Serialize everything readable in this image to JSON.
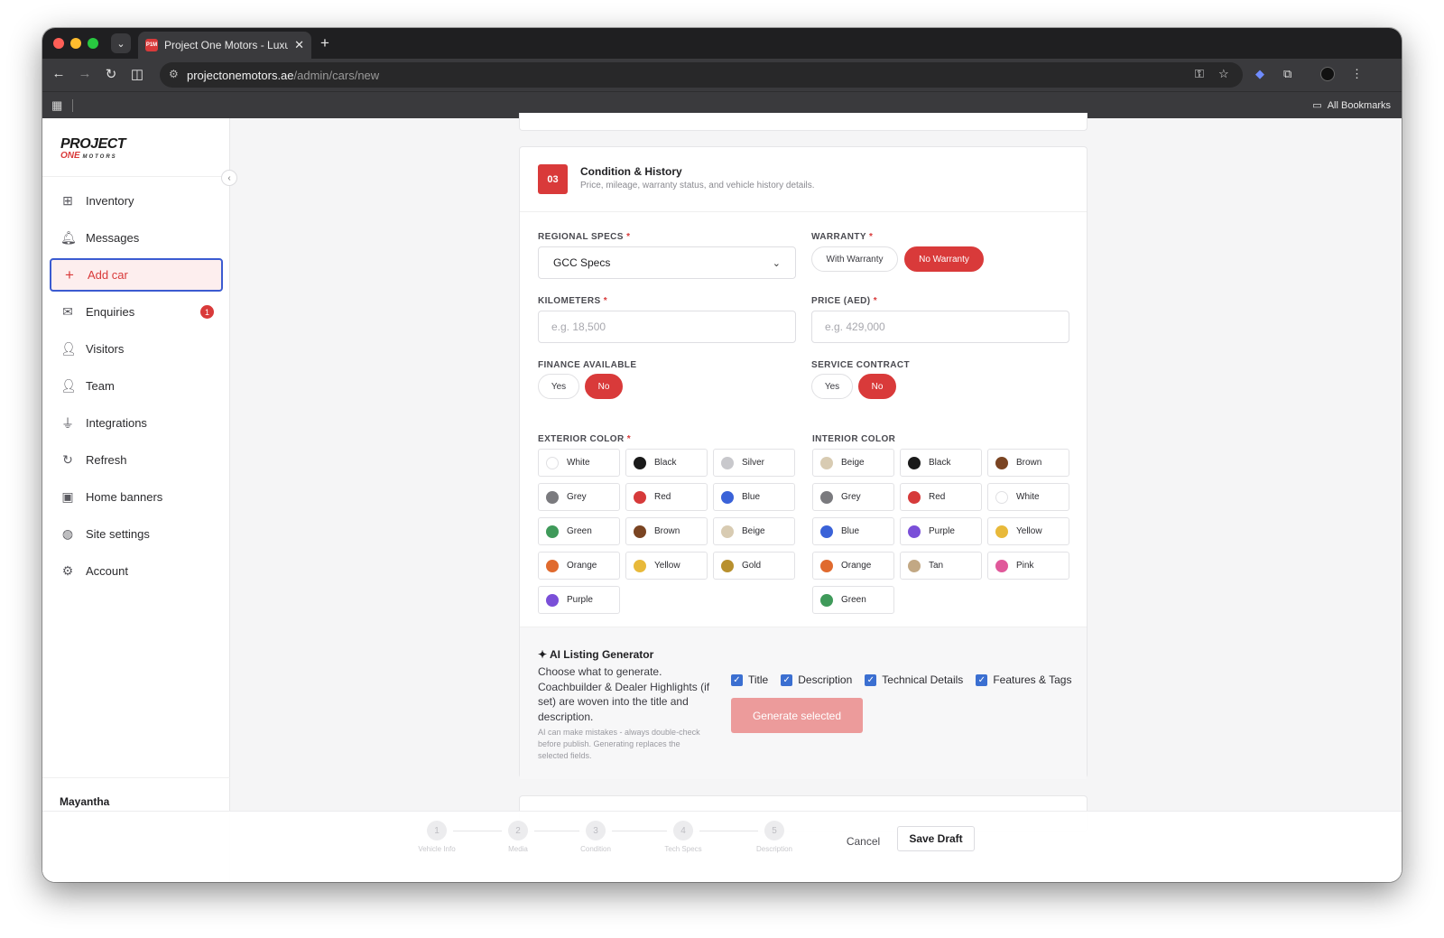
{
  "browser": {
    "tab_title": "Project One Motors - Luxury",
    "favicon_text": "P1M",
    "url_host": "projectonemotors.ae",
    "url_path": "/admin/cars/new",
    "bookmarks_all": "All Bookmarks"
  },
  "sidebar": {
    "logo_line1": "PROJECT",
    "logo_line2": "ONE",
    "logo_line3": "MOTORS",
    "items": [
      {
        "label": "Inventory",
        "icon": "grid-icon",
        "glyph": "⊞"
      },
      {
        "label": "Messages",
        "icon": "bell-icon",
        "glyph": "🔔︎"
      },
      {
        "label": "Add car",
        "icon": "plus-icon",
        "glyph": "+"
      },
      {
        "label": "Enquiries",
        "icon": "mail-icon",
        "glyph": "✉",
        "badge": "1"
      },
      {
        "label": "Visitors",
        "icon": "user-icon",
        "glyph": "👤︎"
      },
      {
        "label": "Team",
        "icon": "users-icon",
        "glyph": "👤︎"
      },
      {
        "label": "Integrations",
        "icon": "plug-icon",
        "glyph": "⏚"
      },
      {
        "label": "Refresh",
        "icon": "refresh-icon",
        "glyph": "↻"
      },
      {
        "label": "Home banners",
        "icon": "image-icon",
        "glyph": "▣"
      },
      {
        "label": "Site settings",
        "icon": "globe-icon",
        "glyph": "◍"
      },
      {
        "label": "Account",
        "icon": "gear-icon",
        "glyph": "⚙"
      }
    ],
    "user_name": "Mayantha"
  },
  "section": {
    "number": "03",
    "title": "Condition & History",
    "subtitle": "Price, mileage, warranty status, and vehicle history details."
  },
  "form": {
    "regional_specs": {
      "label": "REGIONAL SPECS",
      "value": "GCC Specs"
    },
    "warranty": {
      "label": "WARRANTY",
      "options": [
        "With Warranty",
        "No Warranty"
      ],
      "selected": "No Warranty"
    },
    "kilometers": {
      "label": "KILOMETERS",
      "placeholder": "e.g. 18,500",
      "value": ""
    },
    "price": {
      "label": "PRICE (AED)",
      "placeholder": "e.g. 429,000",
      "value": ""
    },
    "finance": {
      "label": "FINANCE AVAILABLE",
      "options": [
        "Yes",
        "No"
      ],
      "selected": "No"
    },
    "service_contract": {
      "label": "SERVICE CONTRACT",
      "options": [
        "Yes",
        "No"
      ],
      "selected": "No"
    },
    "required_mark": "*"
  },
  "exterior_color": {
    "label": "EXTERIOR COLOR",
    "colors": [
      {
        "name": "White",
        "hex": "#ffffff"
      },
      {
        "name": "Black",
        "hex": "#1a1a1a"
      },
      {
        "name": "Silver",
        "hex": "#c8c8cc"
      },
      {
        "name": "Grey",
        "hex": "#7a7a7e"
      },
      {
        "name": "Red",
        "hex": "#d63a3a"
      },
      {
        "name": "Blue",
        "hex": "#3a62d8"
      },
      {
        "name": "Green",
        "hex": "#3f9a5a"
      },
      {
        "name": "Brown",
        "hex": "#7a4422"
      },
      {
        "name": "Beige",
        "hex": "#d8cbb2"
      },
      {
        "name": "Orange",
        "hex": "#e06a2e"
      },
      {
        "name": "Yellow",
        "hex": "#e8b93a"
      },
      {
        "name": "Gold",
        "hex": "#b8902e"
      },
      {
        "name": "Purple",
        "hex": "#7a4fd8"
      }
    ]
  },
  "interior_color": {
    "label": "INTERIOR COLOR",
    "colors": [
      {
        "name": "Beige",
        "hex": "#d8cbb2"
      },
      {
        "name": "Black",
        "hex": "#1a1a1a"
      },
      {
        "name": "Brown",
        "hex": "#7a4422"
      },
      {
        "name": "Grey",
        "hex": "#7a7a7e"
      },
      {
        "name": "Red",
        "hex": "#d63a3a"
      },
      {
        "name": "White",
        "hex": "#ffffff"
      },
      {
        "name": "Blue",
        "hex": "#3a62d8"
      },
      {
        "name": "Purple",
        "hex": "#7a4fd8"
      },
      {
        "name": "Yellow",
        "hex": "#e8b93a"
      },
      {
        "name": "Orange",
        "hex": "#e06a2e"
      },
      {
        "name": "Tan",
        "hex": "#c2a884"
      },
      {
        "name": "Pink",
        "hex": "#e0589a"
      },
      {
        "name": "Green",
        "hex": "#3f9a5a"
      }
    ]
  },
  "ai": {
    "title": "✦ AI Listing Generator",
    "description": "Choose what to generate. Coachbuilder & Dealer Highlights (if set) are woven into the title and description.",
    "note": "AI can make mistakes - always double-check before publish. Generating replaces the selected fields.",
    "options": [
      "Title",
      "Description",
      "Technical Details",
      "Features & Tags"
    ],
    "button": "Generate selected"
  },
  "stepper": {
    "steps": [
      {
        "num": "1",
        "label": "Vehicle Info"
      },
      {
        "num": "2",
        "label": "Media"
      },
      {
        "num": "3",
        "label": "Condition"
      },
      {
        "num": "4",
        "label": "Tech Specs"
      },
      {
        "num": "5",
        "label": "Description"
      }
    ],
    "cancel": "Cancel",
    "save_draft": "Save Draft"
  },
  "colors": {
    "accent": "#d93a3a",
    "focus": "#3b5bd1",
    "checkbox": "#3b6fd1"
  }
}
